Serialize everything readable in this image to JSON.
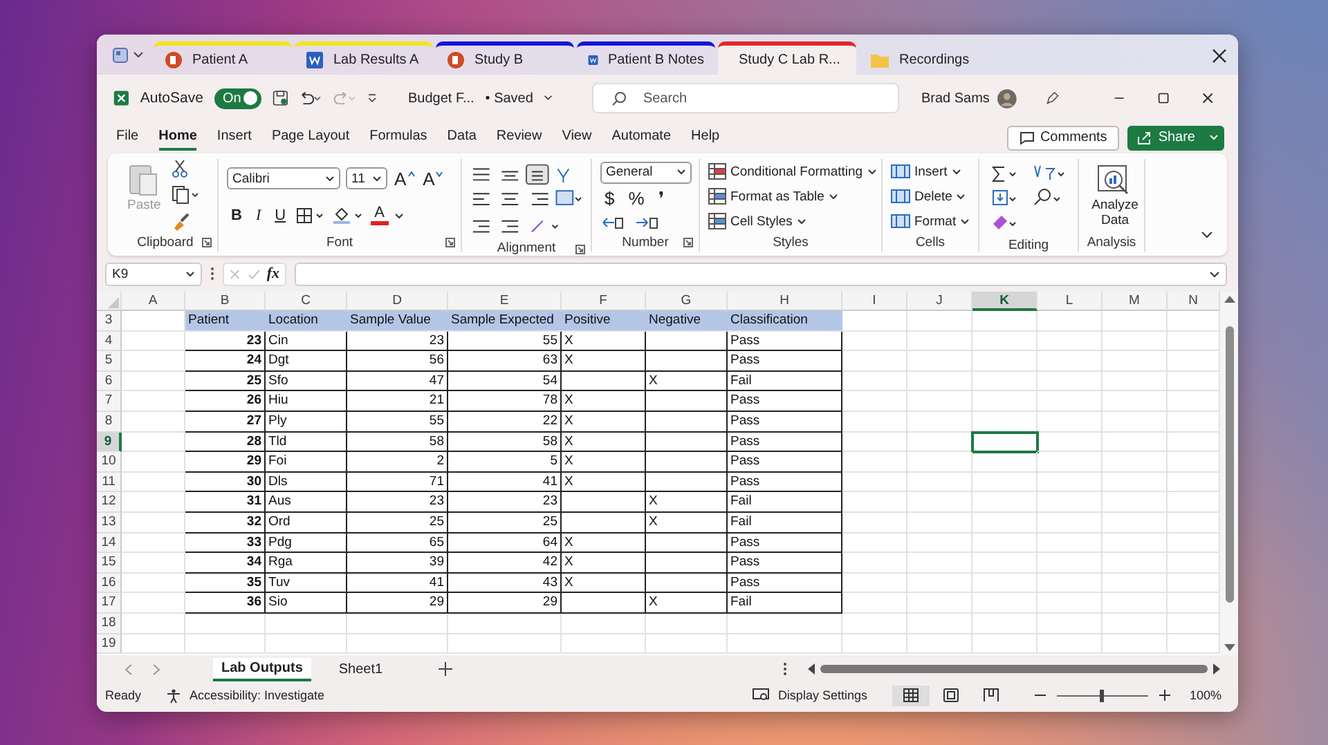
{
  "tabs": [
    {
      "label": "Patient A",
      "kind": "powerpoint",
      "color": "#f2e61a",
      "selected": false
    },
    {
      "label": "Lab Results A",
      "kind": "word",
      "color": "#f2e61a",
      "selected": false
    },
    {
      "label": "Study B",
      "kind": "powerpoint",
      "color": "#1414d8",
      "selected": false
    },
    {
      "label": "Patient B Notes",
      "kind": "word",
      "color": "#1414d8",
      "selected": false
    },
    {
      "label": "Study C Lab R...",
      "kind": "excel",
      "color": "#e02828",
      "selected": true
    },
    {
      "label": "Recordings",
      "kind": "folder",
      "selected": false
    }
  ],
  "title_bar": {
    "autosave_label": "AutoSave",
    "autosave": {
      "label": "On",
      "on": true
    },
    "document": "Budget F...",
    "save_status": "• Saved",
    "search": {
      "placeholder": "Search"
    },
    "user": "Brad Sams"
  },
  "menu": [
    {
      "label": "File",
      "selected": false
    },
    {
      "label": "Home",
      "selected": true
    },
    {
      "label": "Insert",
      "selected": false
    },
    {
      "label": "Page Layout",
      "selected": false
    },
    {
      "label": "Formulas",
      "selected": false
    },
    {
      "label": "Data",
      "selected": false
    },
    {
      "label": "Review",
      "selected": false
    },
    {
      "label": "View",
      "selected": false
    },
    {
      "label": "Automate",
      "selected": false
    },
    {
      "label": "Help",
      "selected": false
    }
  ],
  "comments_button": "Comments",
  "share_button": "Share",
  "ribbon": {
    "clipboard": {
      "label": "Clipboard",
      "paste": {
        "label": "Paste",
        "disabled": true
      }
    },
    "font": {
      "label": "Font",
      "family": "Calibri",
      "size": "11",
      "grow": "A",
      "shrink": "A",
      "style_buttons": [
        "B",
        "I",
        "U"
      ],
      "color_button": "A"
    },
    "alignment": {
      "label": "Alignment"
    },
    "number": {
      "label": "Number",
      "format": "General",
      "buttons": [
        "$",
        "%",
        "❜"
      ]
    },
    "styles": {
      "label": "Styles",
      "items": [
        "Conditional Formatting",
        "Format as Table",
        "Cell Styles"
      ]
    },
    "cells": {
      "label": "Cells",
      "items": [
        "Insert",
        "Delete",
        "Format"
      ]
    },
    "editing": {
      "label": "Editing"
    },
    "analysis": {
      "label": "Analysis",
      "button": "Analyze Data"
    }
  },
  "formula_bar": {
    "name_box": "K9",
    "function_label": "fx"
  },
  "sheet": {
    "columns": [
      {
        "label": "A",
        "selected": false
      },
      {
        "label": "B",
        "selected": false
      },
      {
        "label": "C",
        "selected": false
      },
      {
        "label": "D",
        "selected": false
      },
      {
        "label": "E",
        "selected": false
      },
      {
        "label": "F",
        "selected": false
      },
      {
        "label": "G",
        "selected": false
      },
      {
        "label": "H",
        "selected": false
      },
      {
        "label": "I",
        "selected": false
      },
      {
        "label": "J",
        "selected": false
      },
      {
        "label": "K",
        "selected": true
      },
      {
        "label": "L",
        "selected": false
      },
      {
        "label": "M",
        "selected": false
      },
      {
        "label": "N",
        "selected": false
      }
    ],
    "row_numbers": [
      {
        "label": "3",
        "selected": false
      },
      {
        "label": "4",
        "selected": false
      },
      {
        "label": "5",
        "selected": false
      },
      {
        "label": "6",
        "selected": false
      },
      {
        "label": "7",
        "selected": false
      },
      {
        "label": "8",
        "selected": false
      },
      {
        "label": "9",
        "selected": true
      },
      {
        "label": "10",
        "selected": false
      },
      {
        "label": "11",
        "selected": false
      },
      {
        "label": "12",
        "selected": false
      },
      {
        "label": "13",
        "selected": false
      },
      {
        "label": "14",
        "selected": false
      },
      {
        "label": "15",
        "selected": false
      },
      {
        "label": "16",
        "selected": false
      },
      {
        "label": "17",
        "selected": false
      },
      {
        "label": "18",
        "selected": false
      },
      {
        "label": "19",
        "selected": false
      }
    ],
    "table": {
      "columns": [
        "Patient",
        "Location",
        "Sample Value",
        "Sample Expected",
        "Positive",
        "Negative",
        "Classification"
      ],
      "rows": [
        {
          "patient": "23",
          "location": "Cin",
          "sample_value": "23",
          "sample_expected": "55",
          "positive": "X",
          "classification": "Pass"
        },
        {
          "patient": "24",
          "location": "Dgt",
          "sample_value": "56",
          "sample_expected": "63",
          "positive": "X",
          "classification": "Pass"
        },
        {
          "patient": "25",
          "location": "Sfo",
          "sample_value": "47",
          "sample_expected": "54",
          "negative": "X",
          "classification": "Fail"
        },
        {
          "patient": "26",
          "location": "Hiu",
          "sample_value": "21",
          "sample_expected": "78",
          "positive": "X",
          "classification": "Pass"
        },
        {
          "patient": "27",
          "location": "Ply",
          "sample_value": "55",
          "sample_expected": "22",
          "positive": "X",
          "classification": "Pass"
        },
        {
          "patient": "28",
          "location": "Tld",
          "sample_value": "58",
          "sample_expected": "58",
          "positive": "X",
          "classification": "Pass"
        },
        {
          "patient": "29",
          "location": "Foi",
          "sample_value": "2",
          "sample_expected": "5",
          "positive": "X",
          "classification": "Pass"
        },
        {
          "patient": "30",
          "location": "Dls",
          "sample_value": "71",
          "sample_expected": "41",
          "positive": "X",
          "classification": "Pass"
        },
        {
          "patient": "31",
          "location": "Aus",
          "sample_value": "23",
          "sample_expected": "23",
          "negative": "X",
          "classification": "Fail"
        },
        {
          "patient": "32",
          "location": "Ord",
          "sample_value": "25",
          "sample_expected": "25",
          "negative": "X",
          "classification": "Fail"
        },
        {
          "patient": "33",
          "location": "Pdg",
          "sample_value": "65",
          "sample_expected": "64",
          "positive": "X",
          "classification": "Pass"
        },
        {
          "patient": "34",
          "location": "Rga",
          "sample_value": "39",
          "sample_expected": "42",
          "positive": "X",
          "classification": "Pass"
        },
        {
          "patient": "35",
          "location": "Tuv",
          "sample_value": "41",
          "sample_expected": "43",
          "positive": "X",
          "classification": "Pass"
        },
        {
          "patient": "36",
          "location": "Sio",
          "sample_value": "29",
          "sample_expected": "29",
          "negative": "X",
          "classification": "Fail"
        }
      ]
    }
  },
  "sheet_tabs": [
    {
      "label": "Lab Outputs",
      "selected": true
    },
    {
      "label": "Sheet1",
      "selected": false
    }
  ],
  "status_bar": {
    "ready": "Ready",
    "accessibility": "Accessibility: Investigate",
    "display_settings": "Display Settings",
    "views": [
      {
        "kind": "normal",
        "selected": true
      },
      {
        "kind": "page_layout",
        "selected": false
      },
      {
        "kind": "page_break",
        "selected": false
      }
    ],
    "zoom": {
      "level": 0.5,
      "reading": "100%"
    }
  }
}
